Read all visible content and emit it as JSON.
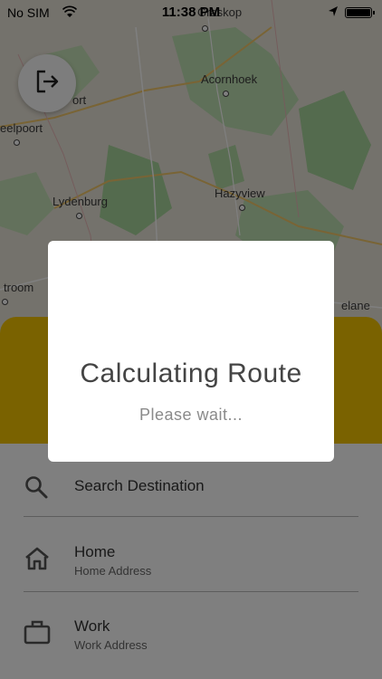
{
  "status_bar": {
    "carrier": "No SIM",
    "time": "11:38 PM"
  },
  "map": {
    "places": {
      "graskop": "Graskop",
      "acornhoek": "Acornhoek",
      "sabie": "ort",
      "steelpoort": "eelpoort",
      "lydenburg": "Lydenburg",
      "hazyview": "Hazyview",
      "roossenekal": "troom",
      "malelane": "elane"
    }
  },
  "dialog": {
    "title": "Calculating Route",
    "subtitle": "Please wait..."
  },
  "destinations": [
    {
      "title": "Search Destination",
      "subtitle": ""
    },
    {
      "title": "Home",
      "subtitle": "Home Address"
    },
    {
      "title": "Work",
      "subtitle": "Work Address"
    }
  ],
  "colors": {
    "accent_yellow": "#f4c400",
    "overlay": "rgba(0,0,0,0.5)"
  },
  "icons": {
    "logout": "logout-icon",
    "search": "search-icon",
    "home": "home-icon",
    "work": "briefcase-icon"
  }
}
